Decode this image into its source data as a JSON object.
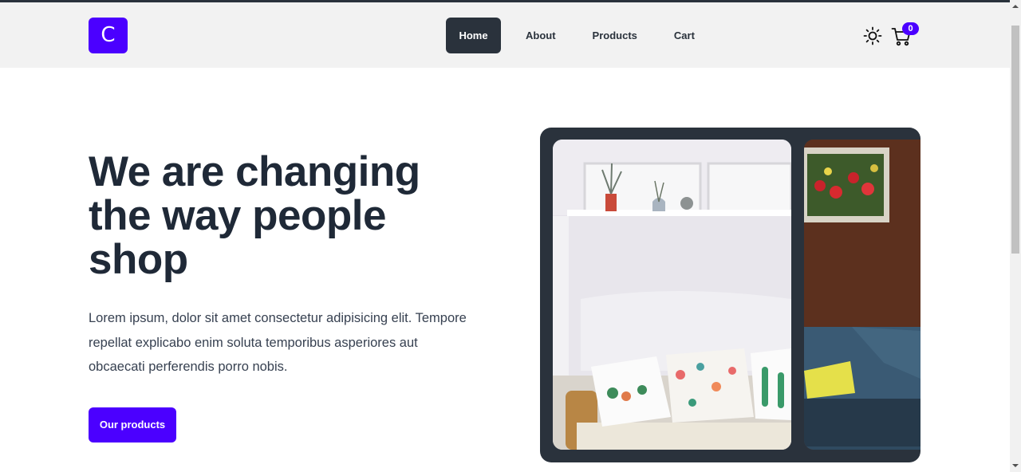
{
  "header": {
    "logo_letter": "C",
    "nav": [
      {
        "label": "Home",
        "active": true
      },
      {
        "label": "About",
        "active": false
      },
      {
        "label": "Products",
        "active": false
      },
      {
        "label": "Cart",
        "active": false
      }
    ],
    "theme_icon": "sun-icon",
    "cart_icon": "cart-icon",
    "cart_count": "0"
  },
  "hero": {
    "title": "We are changing the way people shop",
    "text": "Lorem ipsum, dolor sit amet consectetur adipisicing elit. Tempore repellat explicabo enim soluta temporibus asperiores aut obcaecati perferendis porro nobis.",
    "cta_label": "Our products"
  },
  "colors": {
    "accent": "#4b00ff",
    "dark": "#2a323c",
    "nav_bg": "#f2f2f2"
  }
}
